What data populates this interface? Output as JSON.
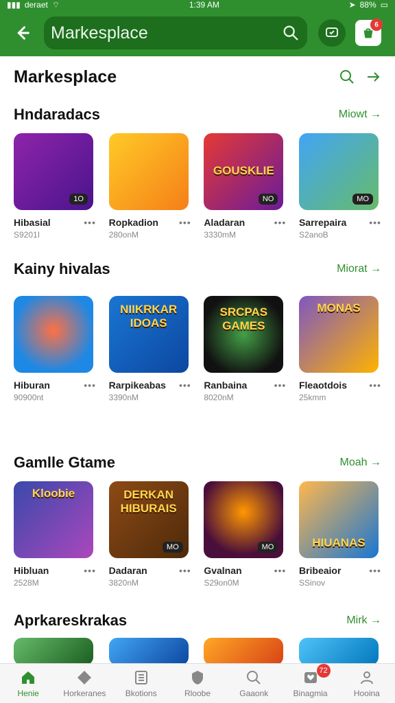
{
  "status": {
    "carrier": "deraet",
    "time": "1:39 AM",
    "battery": "88%"
  },
  "app_bar": {
    "back_icon": "back-arrow-icon",
    "search_label": "Markesplace",
    "search_icon": "search-icon",
    "round_icon": "chat-bubble-icon",
    "bag_icon": "bag-icon",
    "bag_badge": "6"
  },
  "page": {
    "title": "Markesplace",
    "search_icon": "search-icon",
    "arrow_icon": "arrow-right-icon"
  },
  "sections": [
    {
      "title": "Hndaradacs",
      "more": "Miowt →",
      "items": [
        {
          "title": "Hibasial",
          "sub": "S9201I",
          "dots": "•••",
          "badge": "1O",
          "bg": "#7b2bb7",
          "text": ""
        },
        {
          "title": "Ropkadion",
          "sub": "280onM",
          "dots": "•••",
          "badge": "",
          "bg": "#f6b400",
          "text": ""
        },
        {
          "title": "Aladaran",
          "sub": "3330mM",
          "dots": "•••",
          "badge": "NO",
          "bg": "#c62828",
          "text": "GOUSKLIE"
        },
        {
          "title": "Sarrepaira",
          "sub": "S2anoB",
          "dots": "•••",
          "badge": "MO",
          "bg": "#3a8be8",
          "text": ""
        }
      ]
    },
    {
      "title": "Kainy hivalas",
      "more": "Miorat →",
      "items": [
        {
          "title": "Hiburan",
          "sub": "90900nt",
          "dots": "•••",
          "badge": "",
          "bg": "#1e88e5",
          "text": ""
        },
        {
          "title": "Rarpikeabas",
          "sub": "3390nM",
          "dots": "•••",
          "badge": "",
          "bg": "#1565c0",
          "text": "NIIKRKAR IDOAS"
        },
        {
          "title": "Ranbaina",
          "sub": "8020nM",
          "dots": "•••",
          "badge": "",
          "bg": "#1b1b1b",
          "text": "SRCPAS GAMES"
        },
        {
          "title": "Fleaotdois",
          "sub": "25kmm",
          "dots": "•••",
          "badge": "",
          "bg": "#6a3dc8",
          "text": "MONAS"
        }
      ]
    },
    {
      "title": "Gamlle Gtame",
      "more": "Moah →",
      "items": [
        {
          "title": "Hibluan",
          "sub": "2528M",
          "dots": "•••",
          "badge": "",
          "bg": "#3949ab",
          "text": "Kloobie"
        },
        {
          "title": "Dadaran",
          "sub": "3820nM",
          "dots": "•••",
          "badge": "MO",
          "bg": "#8d4a16",
          "text": "DERKAN HIBURAIS"
        },
        {
          "title": "Gvalnan",
          "sub": "S29on0M",
          "dots": "•••",
          "badge": "MO",
          "bg": "#5e1a4a",
          "text": ""
        },
        {
          "title": "Bribeaior",
          "sub": "SSinov",
          "dots": "•••",
          "badge": "",
          "bg": "#1976d2",
          "text": "HIUANAS"
        }
      ]
    },
    {
      "title": "Aprkareskrakas",
      "more": "Mirk →",
      "items": [
        {
          "bg": "#2e7d32"
        },
        {
          "bg": "#1565c0"
        },
        {
          "bg": "#ef6c00"
        },
        {
          "bg": "#0277bd"
        }
      ]
    }
  ],
  "bottom_nav": [
    {
      "label": "Henie",
      "icon": "home-icon",
      "active": true
    },
    {
      "label": "Horkeranes",
      "icon": "diamond-icon"
    },
    {
      "label": "Bkotions",
      "icon": "list-icon"
    },
    {
      "label": "Rloobe",
      "icon": "shield-icon"
    },
    {
      "label": "Gaaonk",
      "icon": "search-icon"
    },
    {
      "label": "Binagmia",
      "icon": "heart-box-icon",
      "badge": "72"
    },
    {
      "label": "Hooina",
      "icon": "profile-icon"
    }
  ]
}
